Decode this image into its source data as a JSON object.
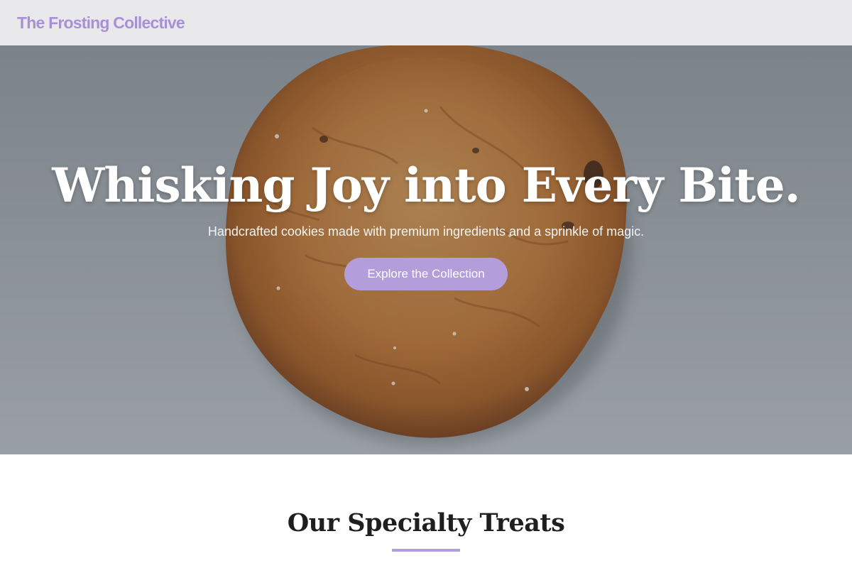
{
  "header": {
    "brand": "The Frosting Collective"
  },
  "hero": {
    "title": "Whisking Joy into Every Bite.",
    "subtitle": "Handcrafted cookies made with premium ingredients and a sprinkle of magic.",
    "cta_label": "Explore the Collection",
    "image_name": "cookie-photo"
  },
  "specialty": {
    "title": "Our Specialty Treats"
  },
  "colors": {
    "accent": "#b39ddb",
    "brand_text": "#a98fd6",
    "header_bg": "#e9e9eb",
    "hero_bg": "#a3abb3"
  }
}
